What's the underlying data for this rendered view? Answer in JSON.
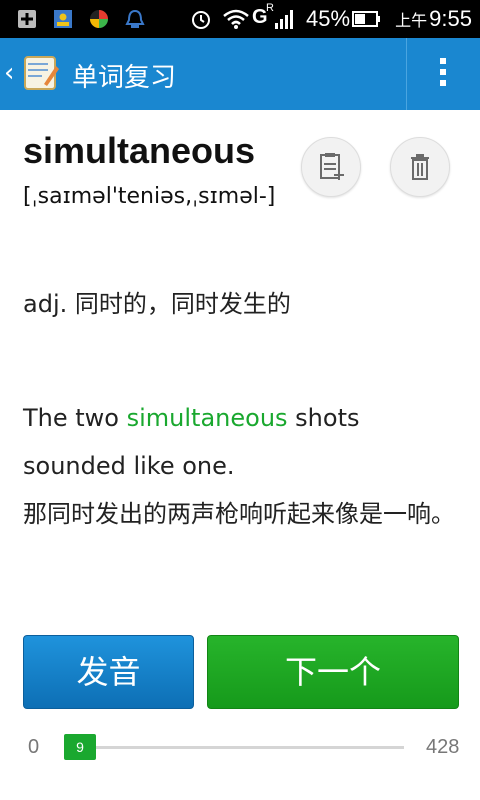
{
  "status_bar": {
    "battery_percent": "45%",
    "ampm": "上午",
    "time": "9:55",
    "network": "G",
    "network_sup": "R"
  },
  "app_bar": {
    "back_glyph": "‹",
    "title": "单词复习",
    "icons": {
      "app": "notepad-icon",
      "menu": "overflow-menu-icon"
    }
  },
  "word": {
    "headword": "simultaneous",
    "phonetic": "[ˌsaɪməl'teniəs,ˌsɪməl-]",
    "meaning": "adj. 同时的，同时发生的",
    "example": {
      "pre": "The two ",
      "highlight": "simultaneous",
      "post": " shots sounded like one.",
      "translation": "那同时发出的两声枪响听起来像是一响。"
    },
    "actions": {
      "add_note": "note-add-icon",
      "delete": "trash-icon"
    }
  },
  "buttons": {
    "pronounce": "发音",
    "next": "下一个"
  },
  "progress": {
    "min": "0",
    "max": "428",
    "current": "9",
    "fraction": 0.021
  },
  "colors": {
    "appbar": "#1a87d0",
    "accent_green": "#1aa82f",
    "button_blue": "#1f93dc"
  }
}
